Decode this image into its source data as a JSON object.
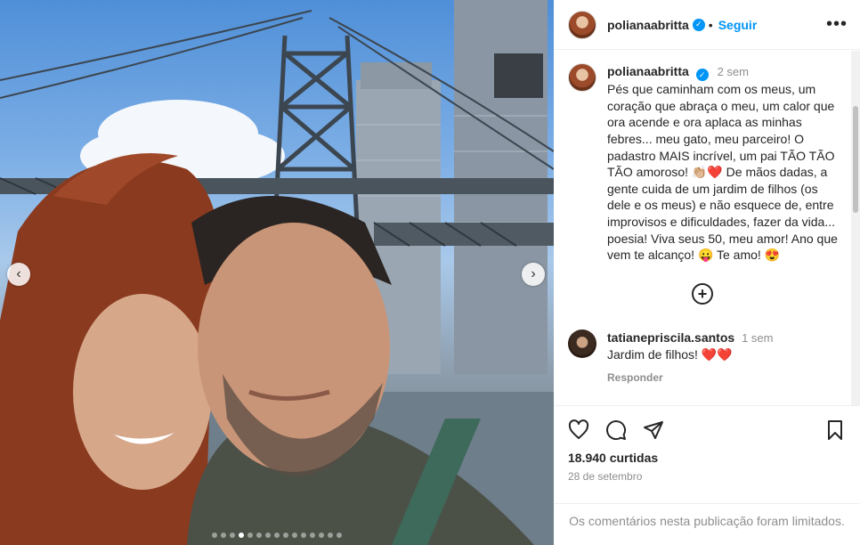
{
  "post": {
    "carousel": {
      "prev_icon": "‹",
      "next_icon": "›",
      "slide_count": 15,
      "active_index": 3
    }
  },
  "header": {
    "username": "polianaabritta",
    "verified_icon": "✓",
    "separator": "•",
    "follow_label": "Seguir",
    "more_icon": "•••"
  },
  "caption": {
    "username": "polianaabritta",
    "verified_icon": "✓",
    "time": "2 sem",
    "text": "Pés que caminham com os meus, um coração que abraça o meu, um calor que ora acende e ora aplaca as minhas febres... meu gato, meu parceiro! O padastro MAIS incrível, um pai TÃO TÃO TÃO amoroso! 👏🏼❤️ De mãos dadas, a gente cuida de um jardim de filhos (os dele e os meus) e não esquece de, entre improvisos e dificuldades, fazer da vida... poesia! Viva seus 50, meu amor! Ano que vem te alcanço! 😛 Te amo! 😍"
  },
  "load_more_icon": "+",
  "comments": [
    {
      "username": "tatianepriscila.santos",
      "time": "1 sem",
      "text": "Jardim de filhos! ❤️❤️",
      "reply_label": "Responder"
    }
  ],
  "actions": {
    "icons": [
      "heart-icon",
      "comment-icon",
      "share-icon",
      "bookmark-icon"
    ],
    "likes": "18.940 curtidas",
    "date": "28 de setembro"
  },
  "footer": {
    "limited_text": "Os comentários nesta publicação foram limitados."
  },
  "colors": {
    "accent": "#0095f6",
    "text": "#262626",
    "muted": "#8e8e8e"
  }
}
